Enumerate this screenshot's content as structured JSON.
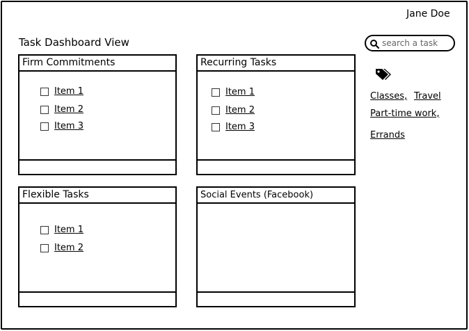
{
  "header": {
    "user_name": "Jane Doe",
    "page_title": "Task Dashboard View"
  },
  "search": {
    "placeholder": "search a task",
    "icon": "search-icon"
  },
  "panels": [
    {
      "title": "Firm Commitments",
      "items": [
        {
          "label": "Item 1",
          "checked": false
        },
        {
          "label": "Item 2",
          "checked": false
        },
        {
          "label": "Item 3",
          "checked": false
        }
      ]
    },
    {
      "title": "Recurring Tasks",
      "items": [
        {
          "label": "Item 1",
          "checked": false
        },
        {
          "label": "Item 2",
          "checked": false
        },
        {
          "label": "Item 3",
          "checked": false
        }
      ]
    },
    {
      "title": "Flexible Tasks",
      "items": [
        {
          "label": "Item 1",
          "checked": false
        },
        {
          "label": "Item 2",
          "checked": false
        }
      ]
    },
    {
      "title": "Social Events (Facebook)",
      "items": []
    }
  ],
  "tags": {
    "icon": "tags-icon",
    "links": [
      "Classes,",
      "Travel",
      "Part-time work,",
      "Errands"
    ]
  }
}
